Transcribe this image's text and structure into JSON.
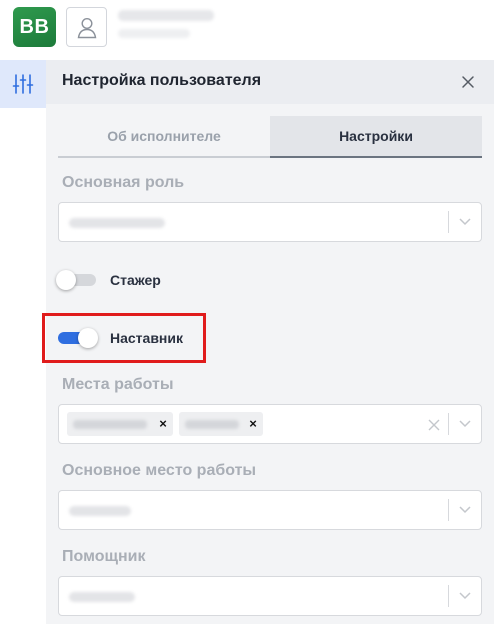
{
  "app": {
    "logo_text": "BB",
    "accent_color": "#2f6ee0",
    "highlight_color": "#e01b1b"
  },
  "panel": {
    "title": "Настройка пользователя",
    "tabs": [
      {
        "label": "Об исполнителе",
        "active": false
      },
      {
        "label": "Настройки",
        "active": true
      }
    ],
    "main_role": {
      "label": "Основная роль"
    },
    "toggles": [
      {
        "label": "Стажер",
        "on": false
      },
      {
        "label": "Наставник",
        "on": true
      }
    ],
    "workplaces": {
      "label": "Места работы",
      "chip_remove_label": "×"
    },
    "main_workplace": {
      "label": "Основное место работы"
    },
    "assistant": {
      "label": "Помощник"
    }
  }
}
